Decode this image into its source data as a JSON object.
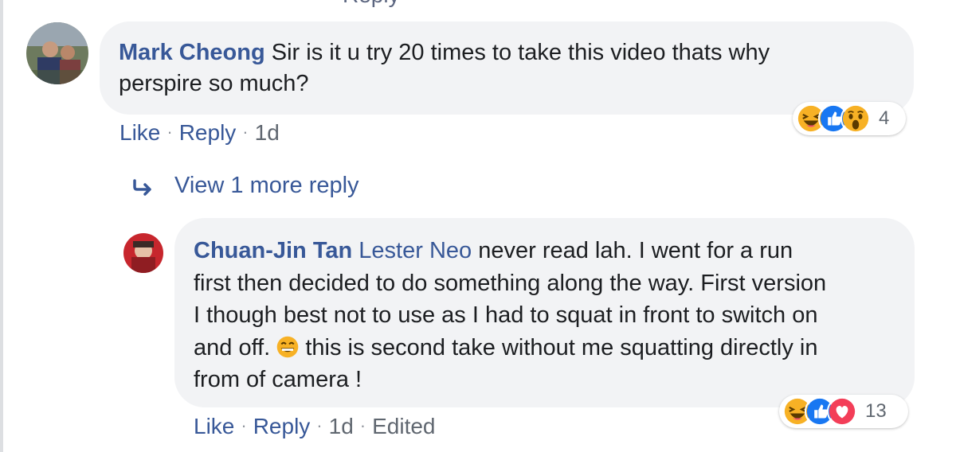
{
  "top_clipped_text": "Reply",
  "comment1": {
    "author": "Mark Cheong",
    "text_line1": "Sir is it u try 20 times to take this video thats why",
    "text_line2": "perspire so much?",
    "actions": {
      "like": "Like",
      "reply": "Reply",
      "time": "1d",
      "separator": "·"
    },
    "reactions": {
      "icons": [
        "haha-icon",
        "like-icon",
        "wow-icon"
      ],
      "count": "4"
    }
  },
  "view_more": {
    "label": "View 1 more reply",
    "icon": "reply-arrow-icon"
  },
  "comment2": {
    "author": "Chuan-Jin Tan",
    "mention": "Lester Neo",
    "lines": [
      " never read lah. I went for a run",
      "first then decided to do something along the way. First version",
      "I though best not to use as I had to squat in front to switch on",
      "and off. ",
      " this is second take without me squatting directly in",
      "from of camera !"
    ],
    "emoji": "grin-emoji",
    "actions": {
      "like": "Like",
      "reply": "Reply",
      "time": "1d",
      "edited": "Edited",
      "separator": "·"
    },
    "reactions": {
      "icons": [
        "haha-icon",
        "like-icon",
        "love-icon"
      ],
      "count": "13"
    }
  },
  "colors": {
    "link": "#385898",
    "bubble": "#f2f3f5",
    "muted": "#606770",
    "like": "#1877f2",
    "love": "#f33e58",
    "haha": "#f7b125"
  }
}
